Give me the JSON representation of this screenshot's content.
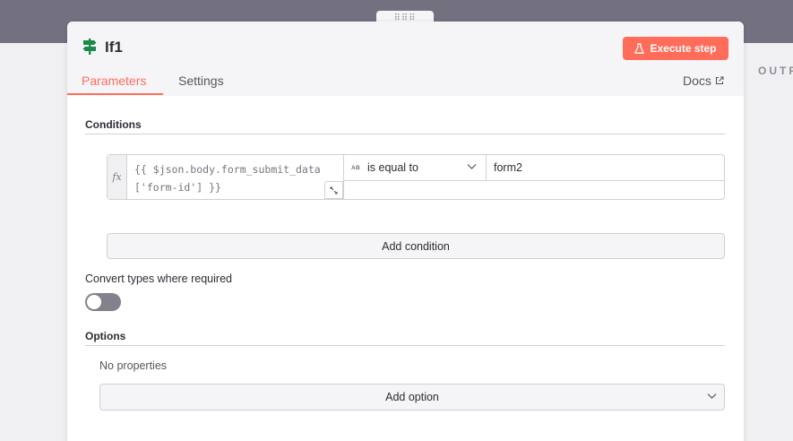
{
  "node": {
    "title": "If1",
    "execute_label": "Execute step",
    "tabs": [
      {
        "label": "Parameters",
        "active": true
      },
      {
        "label": "Settings",
        "active": false
      }
    ],
    "docs_label": "Docs"
  },
  "output_panel": {
    "label": "OUTPUT"
  },
  "conditions": {
    "title": "Conditions",
    "rows": [
      {
        "fx_label": "fx",
        "left_value_lines": [
          "{{ $json.body.form_submit_data",
          "['form-id'] }}"
        ],
        "type_badge": "AB",
        "operator": "is equal to",
        "right_value": "form2"
      }
    ],
    "add_label": "Add condition"
  },
  "convert_types": {
    "label": "Convert types where required",
    "enabled": false
  },
  "options": {
    "title": "Options",
    "empty_text": "No properties",
    "add_label": "Add option"
  },
  "colors": {
    "accent": "#ff6d5a",
    "node_icon": "#1a8a4a",
    "toggle_off": "#82828c",
    "top_band": "#737180"
  }
}
